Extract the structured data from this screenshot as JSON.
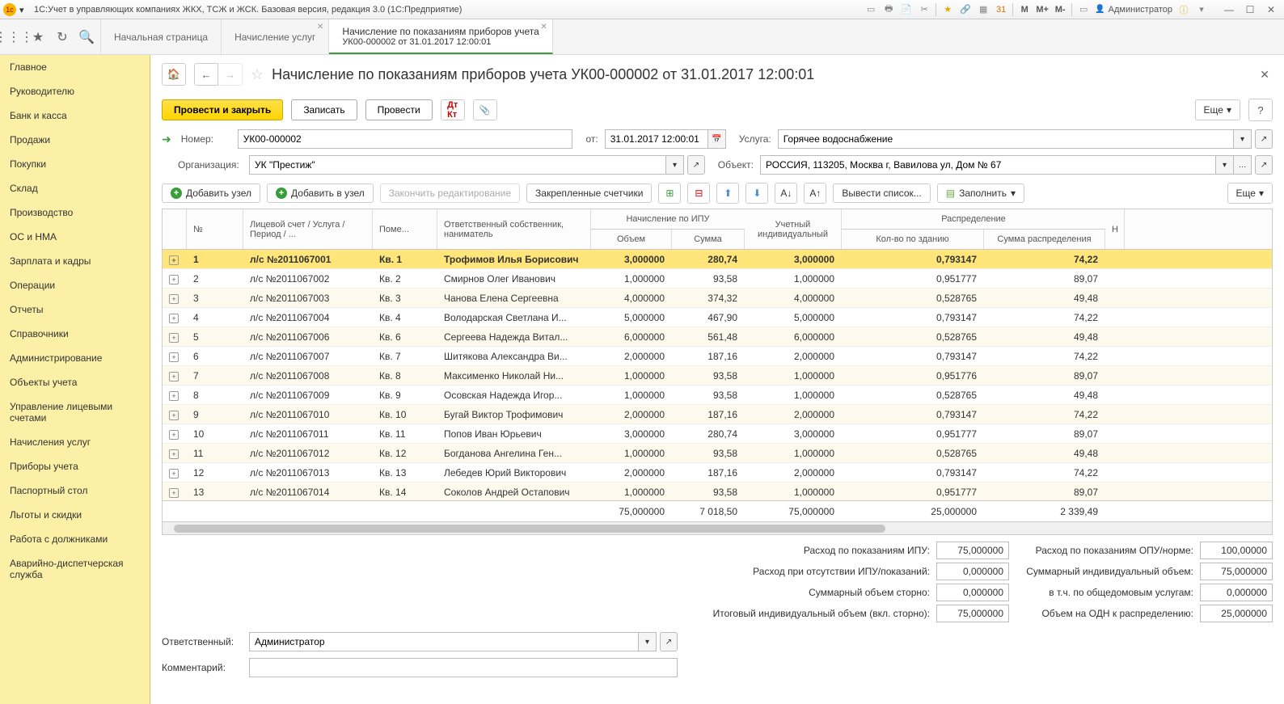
{
  "titlebar": {
    "app_title": "1С:Учет в управляющих компаниях ЖКХ, ТСЖ и ЖСК. Базовая версия, редакция 3.0  (1С:Предприятие)",
    "admin_label": "Администратор",
    "m_labels": [
      "M",
      "M+",
      "M-"
    ]
  },
  "tabs": [
    {
      "label": "Начальная страница"
    },
    {
      "label": "Начисление услуг"
    },
    {
      "label": "Начисление по показаниям приборов учета",
      "sub": "УК00-000002 от 31.01.2017 12:00:01",
      "active": true
    }
  ],
  "sidebar": [
    "Главное",
    "Руководителю",
    "Банк и касса",
    "Продажи",
    "Покупки",
    "Склад",
    "Производство",
    "ОС и НМА",
    "Зарплата и кадры",
    "Операции",
    "Отчеты",
    "Справочники",
    "Администрирование",
    "Объекты учета",
    "Управление лицевыми счетами",
    "Начисления услуг",
    "Приборы учета",
    "Паспортный стол",
    "Льготы и скидки",
    "Работа с должниками",
    "Аварийно-диспетчерская служба"
  ],
  "page": {
    "title": "Начисление по показаниям приборов учета УК00-000002 от 31.01.2017 12:00:01"
  },
  "actions": {
    "post_close": "Провести и закрыть",
    "write": "Записать",
    "post": "Провести",
    "more": "Еще"
  },
  "form": {
    "number_label": "Номер:",
    "number_value": "УК00-000002",
    "from_label": "от:",
    "date_value": "31.01.2017 12:00:01",
    "service_label": "Услуга:",
    "service_value": "Горячее водоснабжение",
    "org_label": "Организация:",
    "org_value": "УК \"Престиж\"",
    "object_label": "Объект:",
    "object_value": "РОССИЯ, 113205, Москва г, Вавилова ул, Дом № 67"
  },
  "toolbar2": {
    "add_node": "Добавить узел",
    "add_to_node": "Добавить в узел",
    "finish_edit": "Закончить редактирование",
    "pinned": "Закрепленные счетчики",
    "list": "Вывести список...",
    "fill": "Заполнить",
    "more": "Еще"
  },
  "table": {
    "headers": {
      "num": "№",
      "account": "Лицевой счет / Услуга / Период / ...",
      "room": "Поме...",
      "owner": "Ответственный собственник, наниматель",
      "ipu_group": "Начисление по ИПУ",
      "volume": "Объем",
      "sum": "Сумма",
      "individual": "Учетный индивидуальный",
      "dist_group": "Распределение",
      "qty_building": "Кол-во по зданию",
      "dist_sum": "Сумма распределения",
      "h": "Н"
    },
    "rows": [
      {
        "n": "1",
        "acc": "л/с №2011067001",
        "room": "Кв. 1",
        "owner": "Трофимов Илья Борисович",
        "vol": "3,000000",
        "sum": "280,74",
        "ind": "3,000000",
        "qty": "0,793147",
        "dist": "74,22"
      },
      {
        "n": "2",
        "acc": "л/с №2011067002",
        "room": "Кв. 2",
        "owner": "Смирнов Олег Иванович",
        "vol": "1,000000",
        "sum": "93,58",
        "ind": "1,000000",
        "qty": "0,951777",
        "dist": "89,07"
      },
      {
        "n": "3",
        "acc": "л/с №2011067003",
        "room": "Кв. 3",
        "owner": "Чанова Елена Сергеевна",
        "vol": "4,000000",
        "sum": "374,32",
        "ind": "4,000000",
        "qty": "0,528765",
        "dist": "49,48"
      },
      {
        "n": "4",
        "acc": "л/с №2011067004",
        "room": "Кв. 4",
        "owner": "Володарская Светлана И...",
        "vol": "5,000000",
        "sum": "467,90",
        "ind": "5,000000",
        "qty": "0,793147",
        "dist": "74,22"
      },
      {
        "n": "5",
        "acc": "л/с №2011067006",
        "room": "Кв. 6",
        "owner": "Сергеева Надежда Витал...",
        "vol": "6,000000",
        "sum": "561,48",
        "ind": "6,000000",
        "qty": "0,528765",
        "dist": "49,48"
      },
      {
        "n": "6",
        "acc": "л/с №2011067007",
        "room": "Кв. 7",
        "owner": "Шитякова Александра Ви...",
        "vol": "2,000000",
        "sum": "187,16",
        "ind": "2,000000",
        "qty": "0,793147",
        "dist": "74,22"
      },
      {
        "n": "7",
        "acc": "л/с №2011067008",
        "room": "Кв. 8",
        "owner": "Максименко Николай Ни...",
        "vol": "1,000000",
        "sum": "93,58",
        "ind": "1,000000",
        "qty": "0,951776",
        "dist": "89,07"
      },
      {
        "n": "8",
        "acc": "л/с №2011067009",
        "room": "Кв. 9",
        "owner": "Осовская Надежда Игор...",
        "vol": "1,000000",
        "sum": "93,58",
        "ind": "1,000000",
        "qty": "0,528765",
        "dist": "49,48"
      },
      {
        "n": "9",
        "acc": "л/с №2011067010",
        "room": "Кв. 10",
        "owner": "Бугай Виктор Трофимович",
        "vol": "2,000000",
        "sum": "187,16",
        "ind": "2,000000",
        "qty": "0,793147",
        "dist": "74,22"
      },
      {
        "n": "10",
        "acc": "л/с №2011067011",
        "room": "Кв. 11",
        "owner": "Попов Иван Юрьевич",
        "vol": "3,000000",
        "sum": "280,74",
        "ind": "3,000000",
        "qty": "0,951777",
        "dist": "89,07"
      },
      {
        "n": "11",
        "acc": "л/с №2011067012",
        "room": "Кв. 12",
        "owner": "Богданова Ангелина Ген...",
        "vol": "1,000000",
        "sum": "93,58",
        "ind": "1,000000",
        "qty": "0,528765",
        "dist": "49,48"
      },
      {
        "n": "12",
        "acc": "л/с №2011067013",
        "room": "Кв. 13",
        "owner": "Лебедев Юрий Викторович",
        "vol": "2,000000",
        "sum": "187,16",
        "ind": "2,000000",
        "qty": "0,793147",
        "dist": "74,22"
      },
      {
        "n": "13",
        "acc": "л/с №2011067014",
        "room": "Кв. 14",
        "owner": "Соколов Андрей Остапович",
        "vol": "1,000000",
        "sum": "93,58",
        "ind": "1,000000",
        "qty": "0,951777",
        "dist": "89,07"
      }
    ],
    "totals": {
      "vol": "75,000000",
      "sum": "7 018,50",
      "ind": "75,000000",
      "qty": "25,000000",
      "dist": "2 339,49"
    }
  },
  "summary": {
    "ipu_label": "Расход по показаниям ИПУ:",
    "ipu_val": "75,000000",
    "opu_label": "Расход по показаниям ОПУ/норме:",
    "opu_val": "100,00000",
    "noipu_label": "Расход при отсутствии ИПУ/показаний:",
    "noipu_val": "0,000000",
    "sumind_label": "Суммарный индивидуальный объем:",
    "sumind_val": "75,000000",
    "storno_label": "Суммарный объем сторно:",
    "storno_val": "0,000000",
    "odu_label": "в т.ч. по общедомовым услугам:",
    "odu_val": "0,000000",
    "total_label": "Итоговый индивидуальный объем (вкл. сторно):",
    "total_val": "75,000000",
    "odn_label": "Объем на ОДН к распределению:",
    "odn_val": "25,000000"
  },
  "bottom": {
    "resp_label": "Ответственный:",
    "resp_value": "Администратор",
    "comment_label": "Комментарий:"
  }
}
